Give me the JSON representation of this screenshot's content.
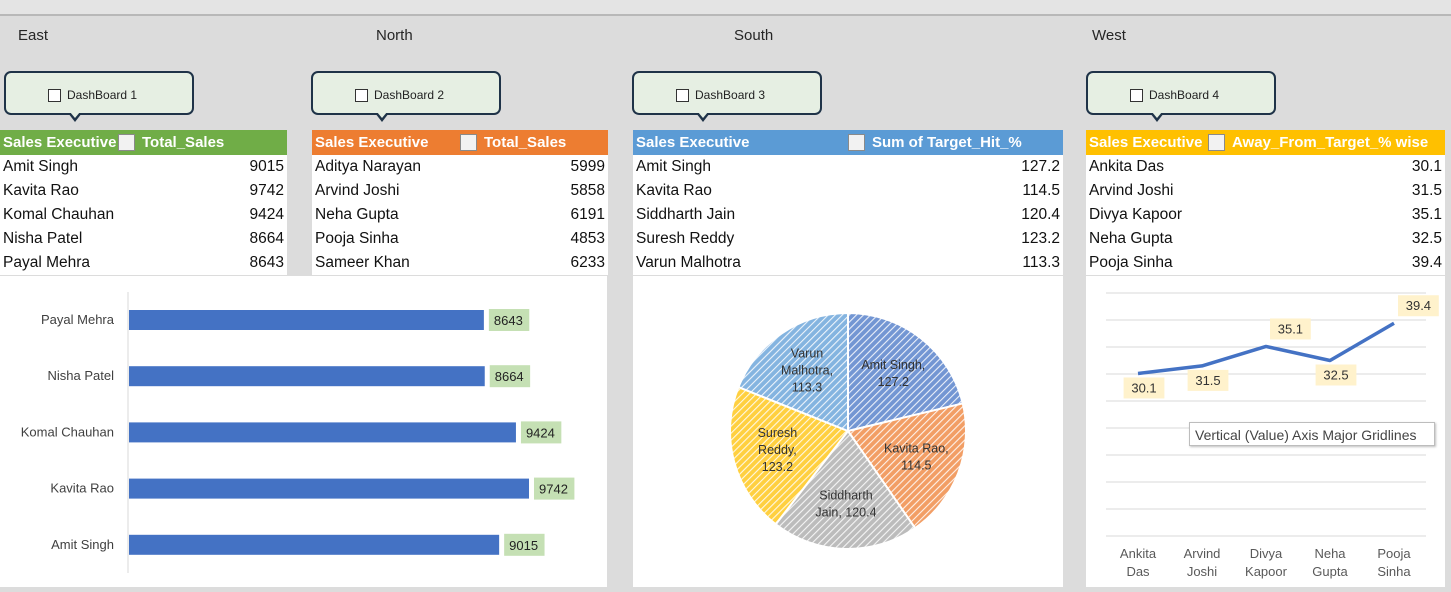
{
  "regions": [
    {
      "label": "East",
      "color": "#f4b183"
    },
    {
      "label": "North",
      "color": "#c5e0b4"
    },
    {
      "label": "South",
      "color": "#f4b183"
    },
    {
      "label": "West",
      "color": "#f4b183"
    }
  ],
  "dashboards": [
    "DashBoard 1",
    "DashBoard 2",
    "DashBoard 3",
    "DashBoard 4"
  ],
  "pivots": [
    {
      "col1": "Sales Executive",
      "col2": "Total_Sales",
      "color": "#70ad47",
      "rows": [
        {
          "name": "Amit Singh",
          "value": "9015"
        },
        {
          "name": "Kavita Rao",
          "value": "9742"
        },
        {
          "name": "Komal Chauhan",
          "value": "9424"
        },
        {
          "name": "Nisha Patel",
          "value": "8664"
        },
        {
          "name": "Payal Mehra",
          "value": "8643"
        }
      ]
    },
    {
      "col1": "Sales Executive",
      "col2": "Total_Sales",
      "color": "#ed7d31",
      "rows": [
        {
          "name": "Aditya Narayan",
          "value": "5999"
        },
        {
          "name": "Arvind Joshi",
          "value": "5858"
        },
        {
          "name": "Neha Gupta",
          "value": "6191"
        },
        {
          "name": "Pooja Sinha",
          "value": "4853"
        },
        {
          "name": "Sameer Khan",
          "value": "6233"
        }
      ]
    },
    {
      "col1": "Sales Executive",
      "col2": "Sum of Target_Hit_%",
      "color": "#5b9bd5",
      "rows": [
        {
          "name": "Amit Singh",
          "value": "127.2"
        },
        {
          "name": "Kavita Rao",
          "value": "114.5"
        },
        {
          "name": "Siddharth Jain",
          "value": "120.4"
        },
        {
          "name": "Suresh Reddy",
          "value": "123.2"
        },
        {
          "name": "Varun Malhotra",
          "value": "113.3"
        }
      ]
    },
    {
      "col1": "Sales Executive",
      "col2": "Away_From_Target_% wise",
      "color": "#ffc000",
      "rows": [
        {
          "name": "Ankita Das",
          "value": "30.1"
        },
        {
          "name": "Arvind Joshi",
          "value": "31.5"
        },
        {
          "name": "Divya Kapoor",
          "value": "35.1"
        },
        {
          "name": "Neha Gupta",
          "value": "32.5"
        },
        {
          "name": "Pooja Sinha",
          "value": "39.4"
        }
      ]
    }
  ],
  "chart_data": [
    {
      "type": "bar",
      "orientation": "horizontal",
      "categories": [
        "Payal Mehra",
        "Nisha Patel",
        "Komal Chauhan",
        "Kavita Rao",
        "Amit Singh"
      ],
      "values": [
        8643,
        8664,
        9424,
        9742,
        9015
      ],
      "bar_color": "#4472c4",
      "label_bg": "#c5e0b4",
      "grid": false
    },
    {
      "type": "pie",
      "slices": [
        {
          "name": "Amit Singh",
          "value": 127.2,
          "label": [
            "Amit Singh,",
            "127.2"
          ],
          "color": "#4472c4"
        },
        {
          "name": "Kavita Rao",
          "value": 114.5,
          "label": [
            "Kavita Rao,",
            "114.5"
          ],
          "color": "#ed7d31"
        },
        {
          "name": "Siddharth Jain",
          "value": 120.4,
          "label": [
            "Siddharth",
            "Jain, 120.4"
          ],
          "color": "#a5a5a5"
        },
        {
          "name": "Suresh Reddy",
          "value": 123.2,
          "label": [
            "Suresh",
            "Reddy,",
            "123.2"
          ],
          "color": "#ffc000"
        },
        {
          "name": "Varun Malhotra",
          "value": 113.3,
          "label": [
            "Varun",
            "Malhotra,",
            "113.3"
          ],
          "color": "#5b9bd5"
        }
      ],
      "pattern": "diagonal-hatch"
    },
    {
      "type": "line",
      "categories": [
        [
          "Ankita",
          "Das"
        ],
        [
          "Arvind",
          "Joshi"
        ],
        [
          "Divya",
          "Kapoor"
        ],
        [
          "Neha",
          "Gupta"
        ],
        [
          "Pooja",
          "Sinha"
        ]
      ],
      "values": [
        30.1,
        31.5,
        35.1,
        32.5,
        39.4
      ],
      "line_color": "#4472c4",
      "label_bg": "#fff2cc",
      "ylim": [
        0,
        45
      ],
      "grid": true
    }
  ],
  "tooltip": "Vertical (Value) Axis Major Gridlines"
}
